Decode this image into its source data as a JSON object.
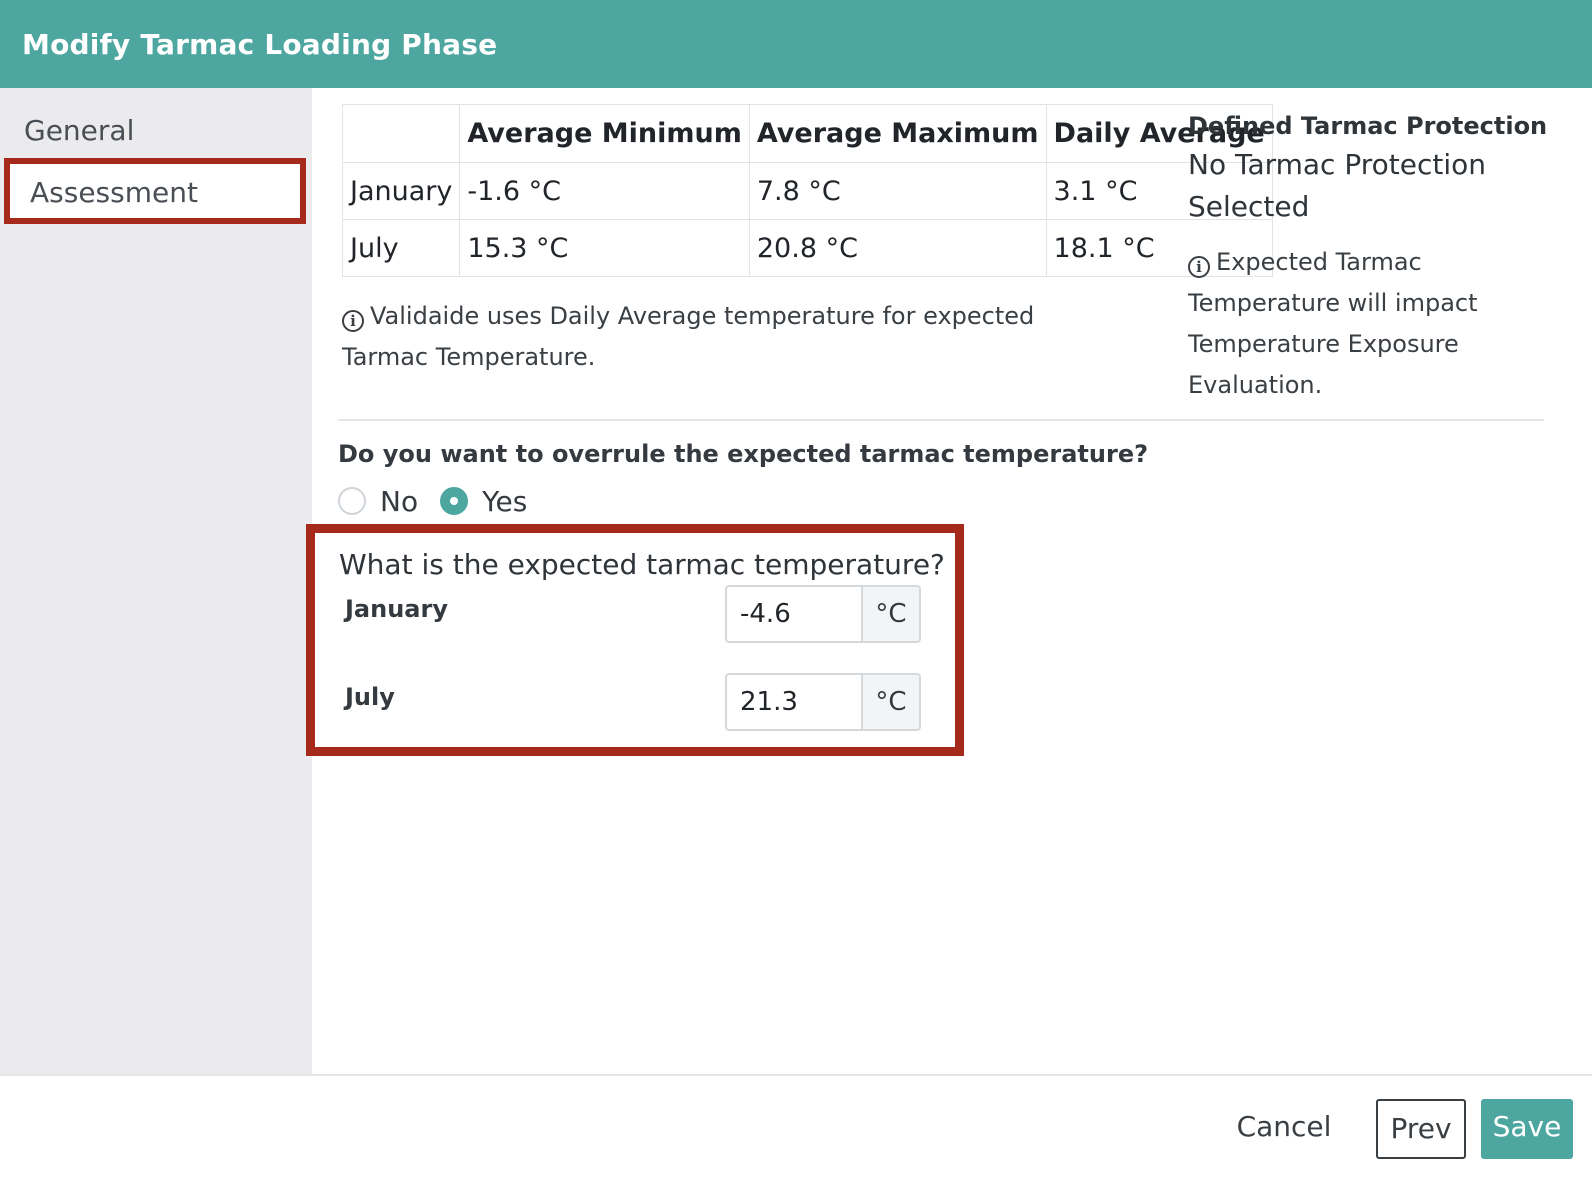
{
  "dialog": {
    "title": "Modify Tarmac Loading Phase"
  },
  "sidebar": {
    "items": [
      {
        "label": "General"
      },
      {
        "label": "Assessment"
      }
    ]
  },
  "climate_table": {
    "headers": [
      "",
      "Average Minimum",
      "Average Maximum",
      "Daily Average"
    ],
    "rows": [
      [
        "January",
        "-1.6 °C",
        "7.8 °C",
        "3.1 °C"
      ],
      [
        "July",
        "15.3 °C",
        "20.8 °C",
        "18.1 °C"
      ]
    ]
  },
  "note": {
    "text": "Validaide uses Daily Average temperature for expected Tarmac Temperature."
  },
  "protection": {
    "title": "Defined Tarmac Protection",
    "value": "No Tarmac Protection Selected",
    "note": "Expected Tarmac Temperature will impact Temperature Exposure Evaluation."
  },
  "overrule": {
    "question": "Do you want to overrule the expected tarmac temperature?",
    "options": [
      {
        "label": "No",
        "selected": false
      },
      {
        "label": "Yes",
        "selected": true
      }
    ]
  },
  "expected": {
    "question": "What is the expected tarmac temperature?",
    "january": {
      "label": "January",
      "value": "-4.6",
      "unit": "°C"
    },
    "july": {
      "label": "July",
      "value": "21.3",
      "unit": "°C"
    }
  },
  "footer": {
    "cancel": "Cancel",
    "prev": "Prev",
    "save": "Save"
  },
  "colors": {
    "accent": "#4ea6a0",
    "highlight": "#a52a1c"
  },
  "icons": {
    "info": "info-circle-icon"
  }
}
